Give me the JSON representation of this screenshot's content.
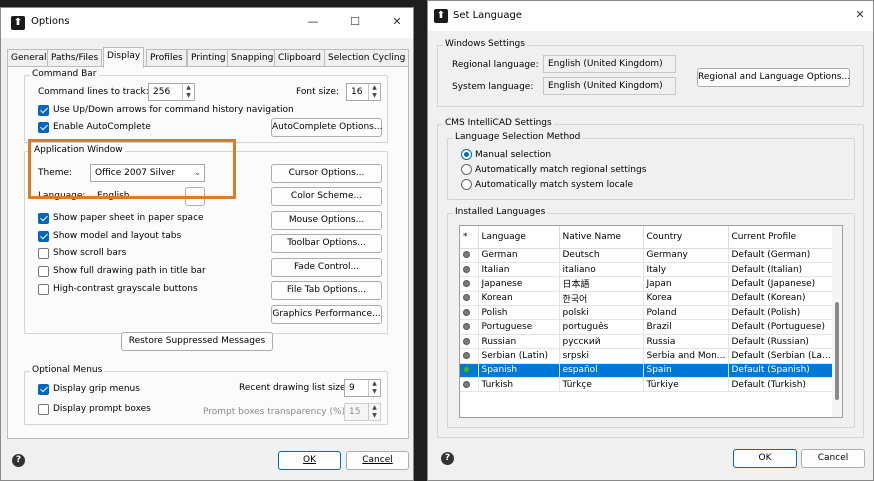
{
  "options": {
    "title": "Options",
    "tabs": [
      "General",
      "Paths/Files",
      "Display",
      "Profiles",
      "Printing",
      "Snapping",
      "Clipboard",
      "Selection Cycling"
    ],
    "command_bar": {
      "label": "Command Bar",
      "lines_label": "Command lines to track:",
      "lines_value": "256",
      "font_size_label": "Font size:",
      "font_size_value": "16",
      "updown_label": "Use Up/Down arrows for command history navigation",
      "autocomplete_label": "Enable AutoComplete",
      "autocomplete_button": "AutoComplete Options..."
    },
    "app_window": {
      "label": "Application Window",
      "theme_label": "Theme:",
      "theme_value": "Office 2007 Silver",
      "language_label": "Language:",
      "language_value": "English",
      "browse_label": "..."
    },
    "display_checks": [
      {
        "label": "Show paper sheet in paper space",
        "checked": true
      },
      {
        "label": "Show model and layout tabs",
        "checked": true
      },
      {
        "label": "Show scroll bars",
        "checked": false
      },
      {
        "label": "Show full drawing path in title bar",
        "checked": false
      },
      {
        "label": "High-contrast grayscale buttons",
        "checked": false
      }
    ],
    "side_buttons": [
      "Cursor Options...",
      "Color Scheme...",
      "Mouse Options...",
      "Toolbar Options...",
      "Fade Control...",
      "File Tab Options...",
      "Graphics Performance..."
    ],
    "restore_button": "Restore Suppressed Messages",
    "optional_menus": {
      "label": "Optional Menus",
      "grip_label": "Display grip menus",
      "prompt_label": "Display prompt boxes",
      "recent_label": "Recent drawing list size:",
      "recent_value": "9",
      "transparency_label": "Prompt boxes transparency (%):",
      "transparency_value": "15"
    },
    "ok": "OK",
    "cancel": "Cancel",
    "help": "?"
  },
  "set_language": {
    "title": "Set Language",
    "windows_settings": {
      "label": "Windows Settings",
      "regional_label": "Regional language:",
      "regional_value": "English (United Kingdom)",
      "system_label": "System language:",
      "system_value": "English (United Kingdom)",
      "regional_button": "Regional and Language Options..."
    },
    "cms_label": "CMS IntelliCAD Settings",
    "method": {
      "label": "Language Selection Method",
      "options": [
        "Manual selection",
        "Automatically match regional settings",
        "Automatically match system locale"
      ],
      "selected_index": 0
    },
    "installed": {
      "label": "Installed Languages",
      "columns": [
        "*",
        "Language",
        "Native Name",
        "Country",
        "Current Profile"
      ],
      "rows": [
        {
          "language": "German",
          "native": "Deutsch",
          "country": "Germany",
          "profile": "Default (German)"
        },
        {
          "language": "Italian",
          "native": "italiano",
          "country": "Italy",
          "profile": "Default (Italian)"
        },
        {
          "language": "Japanese",
          "native": "日本語",
          "country": "Japan",
          "profile": "Default (Japanese)"
        },
        {
          "language": "Korean",
          "native": "한국어",
          "country": "Korea",
          "profile": "Default (Korean)"
        },
        {
          "language": "Polish",
          "native": "polski",
          "country": "Poland",
          "profile": "Default (Polish)"
        },
        {
          "language": "Portuguese",
          "native": "português",
          "country": "Brazil",
          "profile": "Default (Portuguese)"
        },
        {
          "language": "Russian",
          "native": "русский",
          "country": "Russia",
          "profile": "Default (Russian)"
        },
        {
          "language": "Serbian (Latin)",
          "native": "srpski",
          "country": "Serbia and Mon...",
          "profile": "Default (Serbian (La..."
        },
        {
          "language": "Spanish",
          "native": "español",
          "country": "Spain",
          "profile": "Default (Spanish)"
        },
        {
          "language": "Turkish",
          "native": "Türkçe",
          "country": "Türkiye",
          "profile": "Default (Turkish)"
        }
      ],
      "selected_index": 8
    },
    "ok": "OK",
    "cancel": "Cancel",
    "help": "?"
  },
  "colors": {
    "accent": "#0067c0",
    "selection": "#0078d7",
    "highlight_box": "#e07a26",
    "active_dot": "#3cb043"
  }
}
